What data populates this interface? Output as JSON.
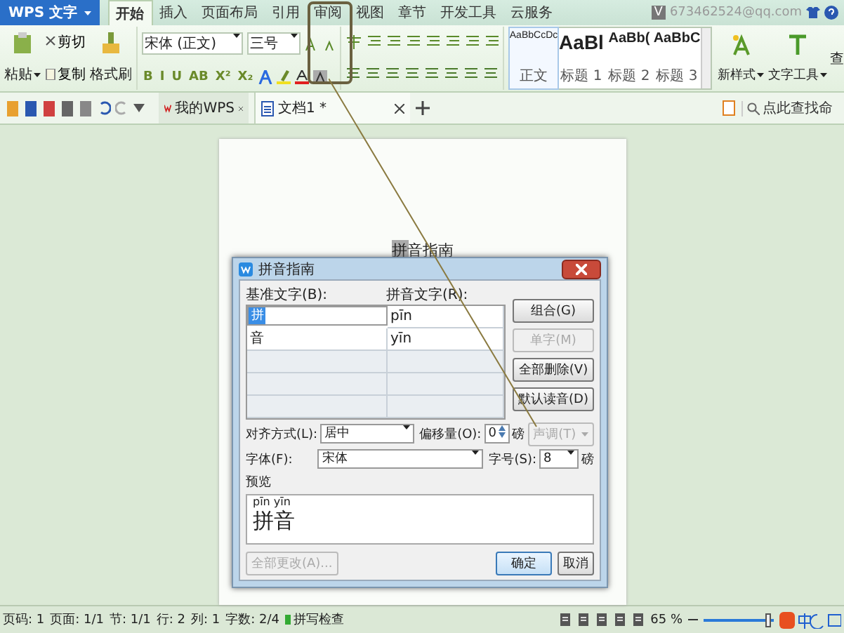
{
  "app_menu": {
    "label": "WPS 文字"
  },
  "tabs": [
    {
      "label": "开始",
      "selected": true
    },
    {
      "label": "插入",
      "selected": false
    },
    {
      "label": "页面布局",
      "selected": false
    },
    {
      "label": "引用",
      "selected": false
    },
    {
      "label": "审阅",
      "selected": false
    },
    {
      "label": "视图",
      "selected": false
    },
    {
      "label": "章节",
      "selected": false
    },
    {
      "label": "开发工具",
      "selected": false
    },
    {
      "label": "云服务",
      "selected": false
    }
  ],
  "account": {
    "badge": "V",
    "email": "673462524@qq.com"
  },
  "clipboard": {
    "paste": "粘贴",
    "cut": "剪切",
    "copy": "复制",
    "format_painter": "格式刷"
  },
  "font": {
    "family": "宋体 (正文)",
    "size": "三号",
    "buttons": [
      "B",
      "I",
      "U",
      "AB",
      "X²",
      "X₂"
    ]
  },
  "styles": [
    {
      "preview": "AaBbCcDc",
      "name": "正文",
      "selected": true,
      "kind": "body"
    },
    {
      "preview": "AaBl",
      "name": "标题 1",
      "selected": false,
      "kind": "h1"
    },
    {
      "preview": "AaBb(",
      "name": "标题 2",
      "selected": false,
      "kind": "h2"
    },
    {
      "preview": "AaBbC",
      "name": "标题 3",
      "selected": false,
      "kind": "h3"
    }
  ],
  "new_style": "新样式",
  "text_tools": "文字工具",
  "cut_off_button": "查",
  "doc_tabs": [
    {
      "label": "我的WPS",
      "selected": false,
      "kind": "home"
    },
    {
      "label": "文档1 *",
      "selected": true,
      "kind": "doc"
    }
  ],
  "search": {
    "placeholder": "点此查找命"
  },
  "document": {
    "text": "拼音指南"
  },
  "dialog": {
    "title": "拼音指南",
    "base_label": "基准文字(B):",
    "ruby_label": "拼音文字(R):",
    "rows": [
      {
        "base": "拼",
        "ruby": "pīn",
        "selected": true
      },
      {
        "base": "音",
        "ruby": "yīn",
        "selected": false
      },
      {
        "base": "",
        "ruby": "",
        "selected": false
      },
      {
        "base": "",
        "ruby": "",
        "selected": false
      },
      {
        "base": "",
        "ruby": "",
        "selected": false
      }
    ],
    "side_buttons": [
      {
        "label": "组合(G)",
        "disabled": false
      },
      {
        "label": "单字(M)",
        "disabled": true
      },
      {
        "label": "全部删除(V)",
        "disabled": false
      },
      {
        "label": "默认读音(D)",
        "disabled": false
      }
    ],
    "align_label": "对齐方式(L):",
    "align_value": "居中",
    "offset_label": "偏移量(O):",
    "offset_value": "0",
    "unit_1": "磅",
    "tone": {
      "label": "声调(T)",
      "disabled": true
    },
    "font_label": "字体(F):",
    "font_value": "宋体",
    "size_label": "字号(S):",
    "size_value": "8",
    "unit_2": "磅",
    "preview_label": "预览",
    "preview_ruby": "pīn yīn",
    "preview_text": "拼音",
    "change_all": {
      "label": "全部更改(A)...",
      "disabled": true
    },
    "ok": "确定",
    "cancel": "取消"
  },
  "status": [
    "页码: 1",
    "页面: 1/1",
    "节: 1/1",
    "行: 2",
    "列: 1",
    "字数: 2/4"
  ],
  "spell_check": "拼写检查",
  "zoom_label": "65 %",
  "zoom": {
    "level": 0.92
  }
}
